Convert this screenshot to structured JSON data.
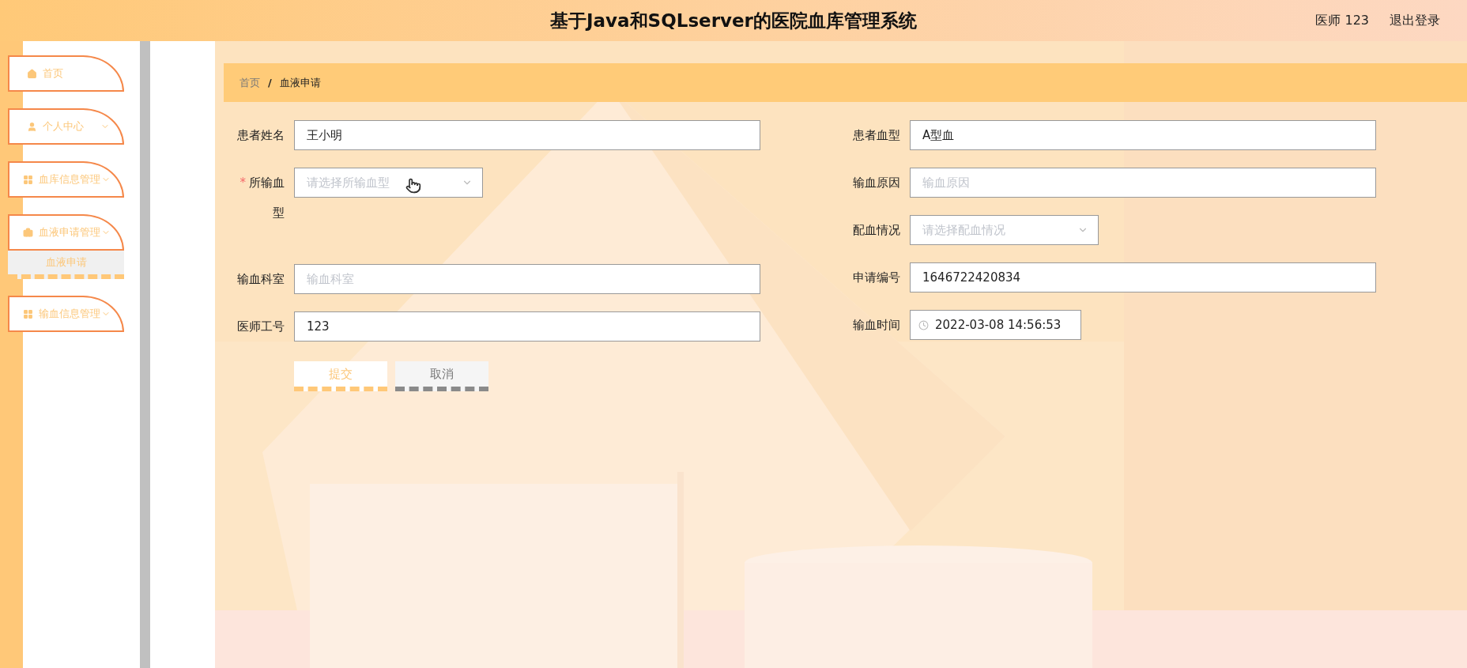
{
  "header": {
    "title": "基于Java和SQLserver的医院血库管理系统",
    "user": "医师 123",
    "logout": "退出登录"
  },
  "sidebar": {
    "items": [
      {
        "label": "首页",
        "kind": "link"
      },
      {
        "label": "个人中心",
        "kind": "submenu"
      },
      {
        "label": "血库信息管理",
        "kind": "submenu"
      },
      {
        "label": "血液申请管理",
        "kind": "submenu",
        "children": [
          {
            "label": "血液申请",
            "selected": true
          }
        ]
      },
      {
        "label": "输血信息管理",
        "kind": "submenu"
      }
    ]
  },
  "breadcrumb": {
    "items": [
      "首页",
      "血液申请"
    ],
    "separator": "/"
  },
  "form": {
    "required_mark": "*",
    "left": [
      {
        "label": "患者姓名",
        "kind": "text",
        "value": "王小明",
        "required": false
      },
      {
        "label": "所输血型",
        "kind": "select",
        "placeholder": "请选择所输血型",
        "required": true
      },
      {
        "label": "输血科室",
        "kind": "text",
        "placeholder": "输血科室",
        "required": false
      },
      {
        "label": "医师工号",
        "kind": "text",
        "value": "123",
        "required": false
      }
    ],
    "right": [
      {
        "label": "患者血型",
        "kind": "text",
        "value": "A型血",
        "required": false
      },
      {
        "label": "输血原因",
        "kind": "text",
        "placeholder": "输血原因",
        "required": false
      },
      {
        "label": "配血情况",
        "kind": "select",
        "placeholder": "请选择配血情况",
        "required": false
      },
      {
        "label": "申请编号",
        "kind": "text",
        "value": "1646722420834",
        "required": false
      },
      {
        "label": "输血时间",
        "kind": "date",
        "value": "2022-03-08 14:56:53",
        "required": false
      }
    ],
    "buttons": [
      {
        "label": "提交",
        "kind": "primary"
      },
      {
        "label": "取消",
        "kind": "default"
      }
    ]
  }
}
